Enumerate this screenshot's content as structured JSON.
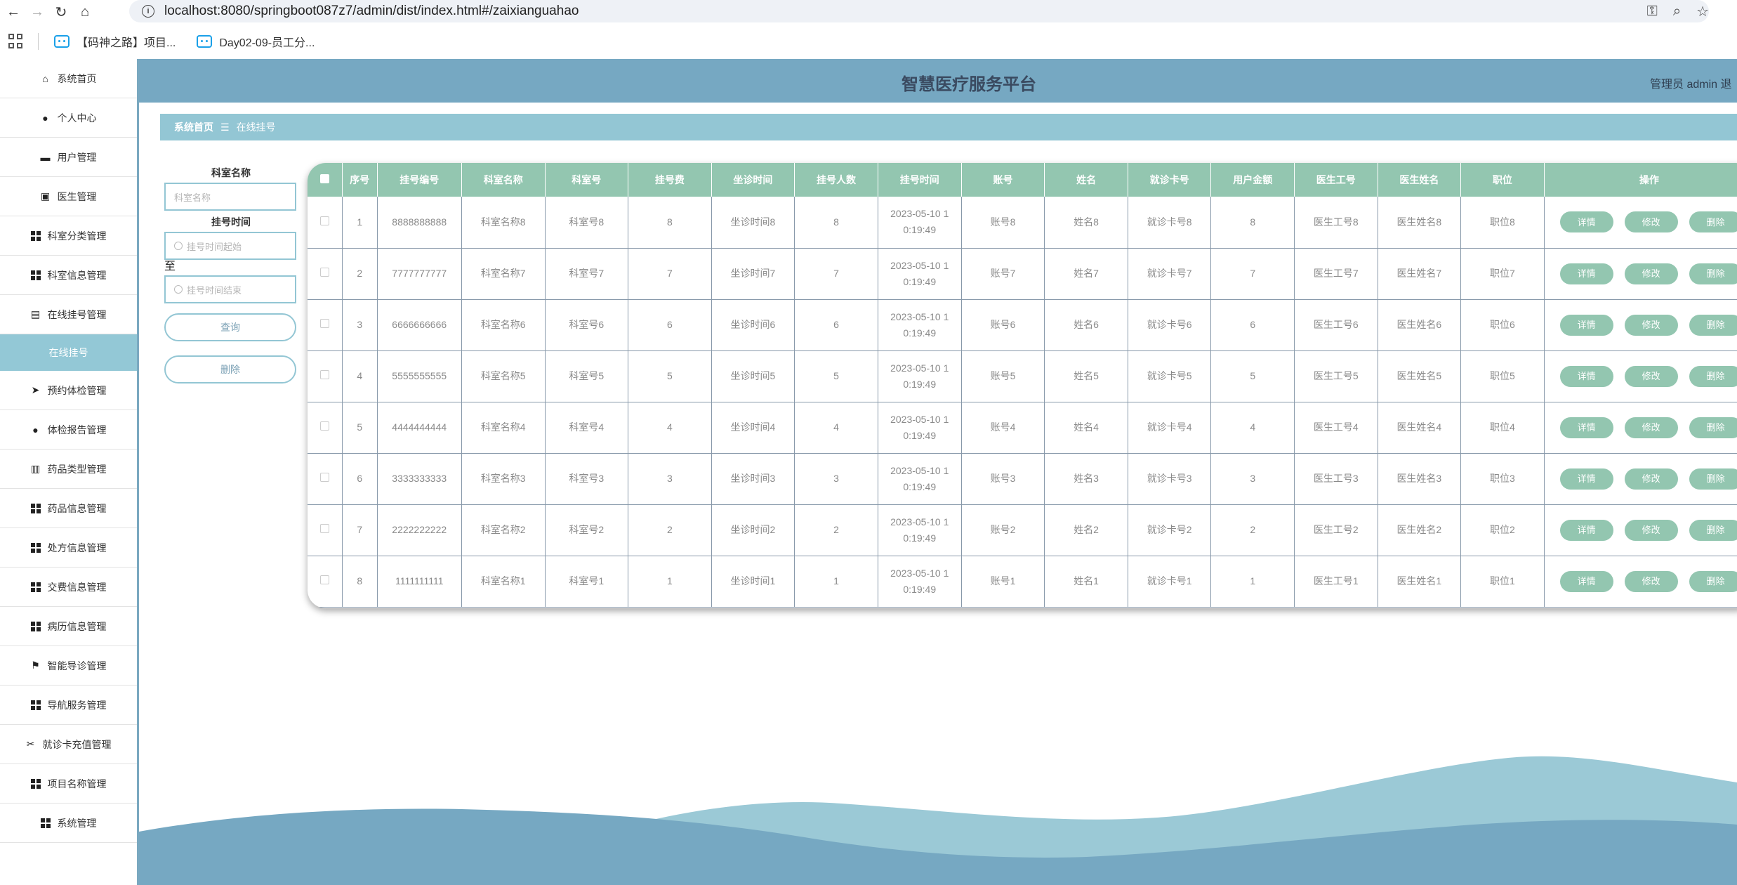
{
  "browser": {
    "url": "localhost:8080/springboot087z7/admin/dist/index.html#/zaixianguahao",
    "bookmarks": [
      "【码神之路】项目...",
      "Day02-09-员工分..."
    ]
  },
  "header": {
    "title": "智慧医疗服务平台",
    "user": "管理员 admin  退"
  },
  "sidebar": {
    "items": [
      {
        "label": "系统首页",
        "icon": "home-icon"
      },
      {
        "label": "个人中心",
        "icon": "user-icon"
      },
      {
        "label": "用户管理",
        "icon": "printer-icon"
      },
      {
        "label": "医生管理",
        "icon": "chart-icon"
      },
      {
        "label": "科室分类管理",
        "icon": "grid-icon"
      },
      {
        "label": "科室信息管理",
        "icon": "grid-icon"
      },
      {
        "label": "在线挂号管理",
        "icon": "briefcase-icon"
      },
      {
        "label": "在线挂号",
        "icon": "",
        "active": true
      },
      {
        "label": "预约体检管理",
        "icon": "send-icon"
      },
      {
        "label": "体检报告管理",
        "icon": "pin-icon"
      },
      {
        "label": "药品类型管理",
        "icon": "clipboard-icon"
      },
      {
        "label": "药品信息管理",
        "icon": "grid-icon"
      },
      {
        "label": "处方信息管理",
        "icon": "grid-icon"
      },
      {
        "label": "交费信息管理",
        "icon": "grid-icon"
      },
      {
        "label": "病历信息管理",
        "icon": "grid-icon"
      },
      {
        "label": "智能导诊管理",
        "icon": "flag-icon"
      },
      {
        "label": "导航服务管理",
        "icon": "grid-icon"
      },
      {
        "label": "就诊卡充值管理",
        "icon": "ticket-icon"
      },
      {
        "label": "项目名称管理",
        "icon": "grid-icon"
      },
      {
        "label": "系统管理",
        "icon": "grid-icon"
      }
    ]
  },
  "breadcrumb": {
    "home": "系统首页",
    "current": "在线挂号"
  },
  "filter": {
    "dept_label": "科室名称",
    "dept_placeholder": "科室名称",
    "time_label": "挂号时间",
    "start_placeholder": "挂号时间起始",
    "to": "至",
    "end_placeholder": "挂号时间结束",
    "query": "查询",
    "delete": "删除"
  },
  "table": {
    "headers": [
      "序号",
      "挂号编号",
      "科室名称",
      "科室号",
      "挂号费",
      "坐诊时间",
      "挂号人数",
      "挂号时间",
      "账号",
      "姓名",
      "就诊卡号",
      "用户金额",
      "医生工号",
      "医生姓名",
      "职位",
      "操作"
    ],
    "actions": [
      "详情",
      "修改",
      "删除"
    ],
    "rows": [
      [
        "1",
        "8888888888",
        "科室名称8",
        "科室号8",
        "8",
        "坐诊时间8",
        "8",
        "2023-05-10 1|0:19:49",
        "账号8",
        "姓名8",
        "就诊卡号8",
        "8",
        "医生工号8",
        "医生姓名8",
        "职位8"
      ],
      [
        "2",
        "7777777777",
        "科室名称7",
        "科室号7",
        "7",
        "坐诊时间7",
        "7",
        "2023-05-10 1|0:19:49",
        "账号7",
        "姓名7",
        "就诊卡号7",
        "7",
        "医生工号7",
        "医生姓名7",
        "职位7"
      ],
      [
        "3",
        "6666666666",
        "科室名称6",
        "科室号6",
        "6",
        "坐诊时间6",
        "6",
        "2023-05-10 1|0:19:49",
        "账号6",
        "姓名6",
        "就诊卡号6",
        "6",
        "医生工号6",
        "医生姓名6",
        "职位6"
      ],
      [
        "4",
        "5555555555",
        "科室名称5",
        "科室号5",
        "5",
        "坐诊时间5",
        "5",
        "2023-05-10 1|0:19:49",
        "账号5",
        "姓名5",
        "就诊卡号5",
        "5",
        "医生工号5",
        "医生姓名5",
        "职位5"
      ],
      [
        "5",
        "4444444444",
        "科室名称4",
        "科室号4",
        "4",
        "坐诊时间4",
        "4",
        "2023-05-10 1|0:19:49",
        "账号4",
        "姓名4",
        "就诊卡号4",
        "4",
        "医生工号4",
        "医生姓名4",
        "职位4"
      ],
      [
        "6",
        "3333333333",
        "科室名称3",
        "科室号3",
        "3",
        "坐诊时间3",
        "3",
        "2023-05-10 1|0:19:49",
        "账号3",
        "姓名3",
        "就诊卡号3",
        "3",
        "医生工号3",
        "医生姓名3",
        "职位3"
      ],
      [
        "7",
        "2222222222",
        "科室名称2",
        "科室号2",
        "2",
        "坐诊时间2",
        "2",
        "2023-05-10 1|0:19:49",
        "账号2",
        "姓名2",
        "就诊卡号2",
        "2",
        "医生工号2",
        "医生姓名2",
        "职位2"
      ],
      [
        "8",
        "1111111111",
        "科室名称1",
        "科室号1",
        "1",
        "坐诊时间1",
        "1",
        "2023-05-10 1|0:19:49",
        "账号1",
        "姓名1",
        "就诊卡号1",
        "1",
        "医生工号1",
        "医生姓名1",
        "职位1"
      ]
    ]
  },
  "colors": {
    "topbar": "#76a8c2",
    "accent": "#93c6d4",
    "table_header": "#93c6b0",
    "wave_light": "#9bc9d6",
    "wave_dark": "#76a8c2"
  }
}
